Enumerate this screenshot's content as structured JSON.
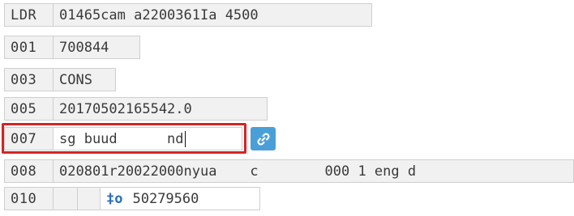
{
  "records": [
    {
      "tag": "LDR",
      "value": "01465cam a2200361Ia 4500"
    },
    {
      "tag": "001",
      "value": "700844"
    },
    {
      "tag": "003",
      "value": "CONS"
    },
    {
      "tag": "005",
      "value": "20170502165542.0"
    },
    {
      "tag": "007",
      "value": "sg buud      nd"
    },
    {
      "tag": "008",
      "value": "020801r20022000nyua    c        000 1 eng d"
    },
    {
      "tag": "010",
      "subfield_code": "‡o",
      "value": "50279560"
    }
  ],
  "colors": {
    "highlight": "#d42424",
    "link_button": "#4a9fd8",
    "subfield": "#2a6ebb"
  },
  "icons": {
    "link_button": "link-icon"
  }
}
